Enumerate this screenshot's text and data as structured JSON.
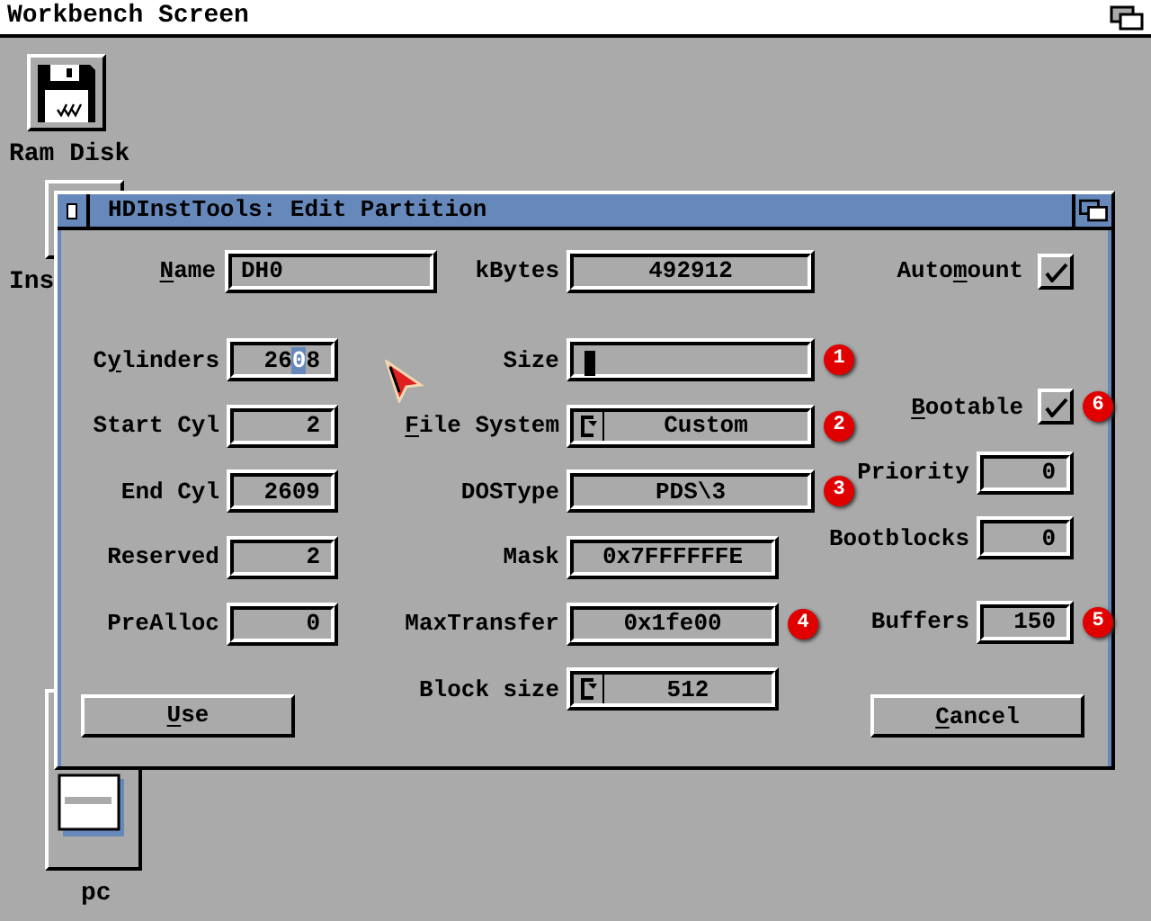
{
  "screen_title": "Workbench Screen",
  "desktop_icons": [
    {
      "kind": "disk",
      "label": "Ram Disk"
    },
    {
      "kind": "tool",
      "label": "Ins"
    },
    {
      "kind": "drawer",
      "label": "pc"
    }
  ],
  "window": {
    "title": "HDInstTools: Edit Partition",
    "top_row": [
      {
        "kind": "text",
        "label": {
          "key": "N",
          "after": "ame"
        },
        "value": "DH0"
      },
      {
        "kind": "readout",
        "label": "kBytes",
        "value": "492912"
      },
      {
        "kind": "checkbox",
        "label": {
          "before": "Auto",
          "key": "m",
          "after": "ount"
        },
        "checked": true
      }
    ],
    "columns": [
      {
        "rows": [
          {
            "kind": "number",
            "label": {
              "before": "C",
              "key": "y",
              "after": "linders"
            },
            "value_parts": {
              "before": "26",
              "cursor": "0",
              "after": "8"
            }
          },
          {
            "kind": "number",
            "label": "Start Cyl",
            "value": "2"
          },
          {
            "kind": "number",
            "label": "End Cyl",
            "value": "2609"
          },
          {
            "kind": "number",
            "label": "Reserved",
            "value": "2"
          },
          {
            "kind": "number",
            "label": "PreAlloc",
            "value": "0"
          }
        ],
        "button": {
          "label": {
            "key": "U",
            "after": "se"
          }
        }
      },
      {
        "rows": [
          {
            "kind": "readout",
            "label": "Size",
            "cursor_block": true,
            "badge": "1"
          },
          {
            "kind": "cycle",
            "label": {
              "key": "F",
              "after": "ile System"
            },
            "value": "Custom",
            "badge": "2"
          },
          {
            "kind": "readout",
            "label": "DOSType",
            "value": "PDS\\3",
            "badge": "3"
          },
          {
            "kind": "readout",
            "label": "Mask",
            "value": "0x7FFFFFFE"
          },
          {
            "kind": "readout",
            "label": "MaxTransfer",
            "value": "0x1fe00",
            "badge": "4"
          },
          {
            "kind": "cycle",
            "label": "Block size",
            "value": "512"
          }
        ]
      },
      {
        "rows": [
          {
            "kind": "checkbox",
            "label": {
              "key": "B",
              "after": "ootable"
            },
            "checked": true,
            "badge": "6"
          },
          {
            "kind": "number",
            "label": "Priority",
            "value": "0"
          },
          {
            "kind": "number",
            "label": "Bootblocks",
            "value": "0"
          },
          {
            "kind": "number",
            "label": "Buffers",
            "value": "150",
            "badge": "5"
          }
        ],
        "button": {
          "label": {
            "key": "C",
            "after": "ancel"
          }
        }
      }
    ]
  }
}
